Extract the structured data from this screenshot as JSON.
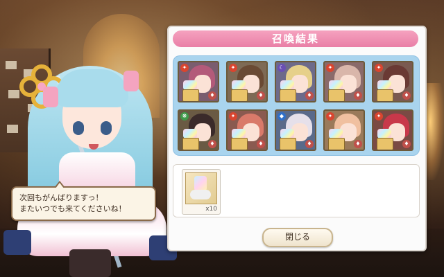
{
  "dialog": {
    "title": "召喚結果",
    "close_label": "閉じる"
  },
  "speech": {
    "line1": "次回もがんばりますっ！",
    "line2": "またいつでも来てくださいね！"
  },
  "cards": [
    {
      "element": "fire",
      "hair_color": "#b35a7a",
      "bg": "#7a5d6f"
    },
    {
      "element": "fire",
      "hair_color": "#6a4a34",
      "bg": "#7e6a55"
    },
    {
      "element": "moon",
      "hair_color": "#e6d08a",
      "bg": "#6d6a8a"
    },
    {
      "element": "fire",
      "hair_color": "#d9b6aa",
      "bg": "#8a6a6a"
    },
    {
      "element": "fire",
      "hair_color": "#6a3a34",
      "bg": "#7a5a50"
    },
    {
      "element": "wind",
      "hair_color": "#3a2a2a",
      "bg": "#6a5a44"
    },
    {
      "element": "fire",
      "hair_color": "#d97a6a",
      "bg": "#8a5a50"
    },
    {
      "element": "water",
      "hair_color": "#e6e0ea",
      "bg": "#5a6a8a"
    },
    {
      "element": "fire",
      "hair_color": "#f0c0a0",
      "bg": "#9a7a5a"
    },
    {
      "element": "fire",
      "hair_color": "#c8384a",
      "bg": "#7a4a44"
    }
  ],
  "items": [
    {
      "icon": "crystal-bundle-icon",
      "count": "x10"
    }
  ],
  "colors": {
    "title_bar": "#e97fa7",
    "card_area": "#a9d4ee"
  }
}
